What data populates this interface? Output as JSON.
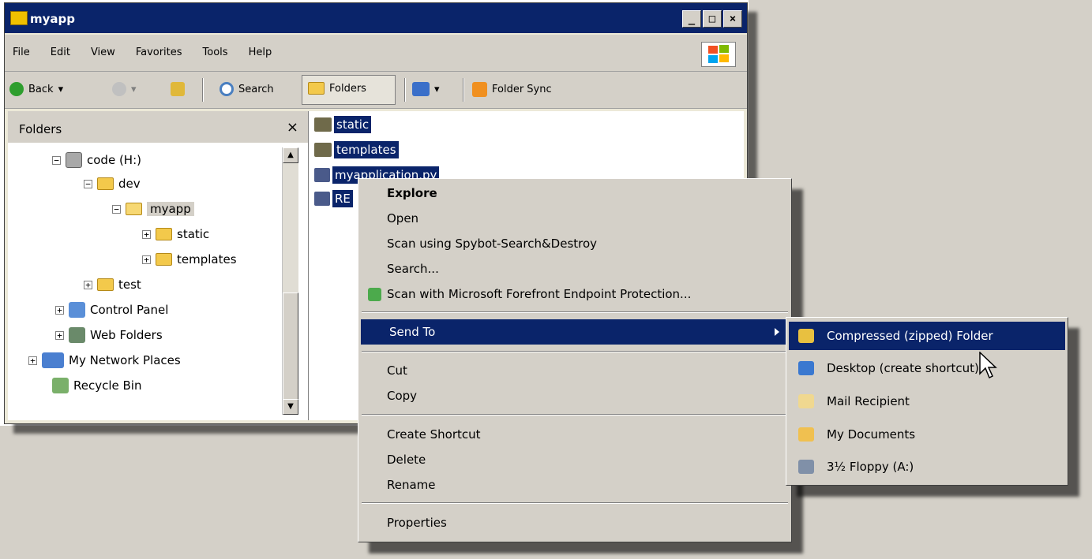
{
  "window": {
    "title": "myapp",
    "controls": [
      "_",
      "□",
      "×"
    ]
  },
  "menubar": {
    "items": [
      "File",
      "Edit",
      "View",
      "Favorites",
      "Tools",
      "Help"
    ]
  },
  "toolbar": {
    "back_label": "Back",
    "search_label": "Search",
    "folders_label": "Folders",
    "folder_sync_label": "Folder Sync",
    "dropdown_arrow": "▾"
  },
  "folders_pane": {
    "title": "Folders",
    "close_glyph": "×",
    "tree": [
      {
        "label": "code (H:)",
        "toggle": "−"
      },
      {
        "label": "dev",
        "toggle": "−"
      },
      {
        "label": "myapp",
        "toggle": "−"
      },
      {
        "label": "static",
        "toggle": "+"
      },
      {
        "label": "templates",
        "toggle": "+"
      },
      {
        "label": "test",
        "toggle": "+"
      },
      {
        "label": "Control Panel",
        "toggle": "+"
      },
      {
        "label": "Web Folders",
        "toggle": "+"
      },
      {
        "label": "My Network Places",
        "toggle": "+"
      },
      {
        "label": "Recycle Bin",
        "toggle": ""
      }
    ]
  },
  "files": [
    {
      "name": "static"
    },
    {
      "name": "templates"
    },
    {
      "name": "myapplication.py"
    },
    {
      "name": "RE"
    }
  ],
  "context_menu": {
    "items": [
      {
        "label": "Explore"
      },
      {
        "label": "Open"
      },
      {
        "label": "Scan using Spybot-Search&Destroy"
      },
      {
        "label": "Search..."
      },
      {
        "label": "Scan with Microsoft Forefront Endpoint Protection..."
      },
      {
        "label": "Send To"
      },
      {
        "label": "Cut"
      },
      {
        "label": "Copy"
      },
      {
        "label": "Create Shortcut"
      },
      {
        "label": "Delete"
      },
      {
        "label": "Rename"
      },
      {
        "label": "Properties"
      }
    ]
  },
  "send_to_menu": {
    "items": [
      {
        "label": "Compressed (zipped) Folder"
      },
      {
        "label": "Desktop (create shortcut)"
      },
      {
        "label": "Mail Recipient"
      },
      {
        "label": "My Documents"
      },
      {
        "label": "3½ Floppy (A:)"
      }
    ]
  },
  "colors": {
    "selection": "#0a246a",
    "face": "#d4d0c8"
  }
}
